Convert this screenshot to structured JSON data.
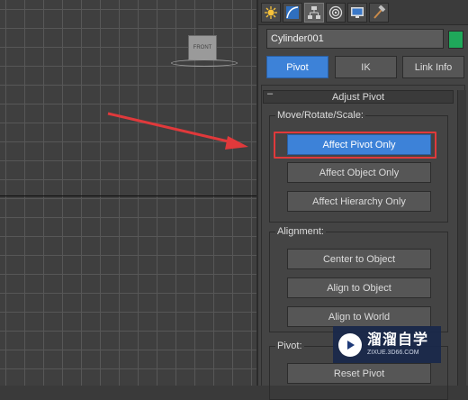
{
  "viewport": {
    "viewcube_label": "FRONT"
  },
  "command_panel": {
    "tabs": [
      {
        "name": "create-tab",
        "icon": "sun-star-icon"
      },
      {
        "name": "modify-tab",
        "icon": "curve-modify-icon"
      },
      {
        "name": "hierarchy-tab",
        "icon": "hierarchy-icon",
        "active": true
      },
      {
        "name": "motion-tab",
        "icon": "motion-disc-icon"
      },
      {
        "name": "display-tab",
        "icon": "display-monitor-icon"
      },
      {
        "name": "utilities-tab",
        "icon": "hammer-icon"
      }
    ],
    "object_name": "Cylinder001",
    "object_color": "#1fa85a",
    "subtabs": {
      "pivot": "Pivot",
      "ik": "IK",
      "link_info": "Link Info"
    },
    "rollout": {
      "collapse_symbol": "–",
      "title": "Adjust Pivot",
      "move_rotate_scale": {
        "label": "Move/Rotate/Scale:",
        "affect_pivot_only": "Affect Pivot Only",
        "affect_object_only": "Affect Object Only",
        "affect_hierarchy_only": "Affect Hierarchy Only"
      },
      "alignment": {
        "label": "Alignment:",
        "center_to_object": "Center to Object",
        "align_to_object": "Align to Object",
        "align_to_world": "Align to World"
      },
      "pivot": {
        "label": "Pivot:",
        "reset_label": "Reset Pivot"
      }
    }
  },
  "annotation": {
    "arrow_color": "#e0393b",
    "highlight_color": "#e0393b"
  },
  "watermark": {
    "title": "溜溜自学",
    "url": "ZIXUE.3D66.COM"
  }
}
